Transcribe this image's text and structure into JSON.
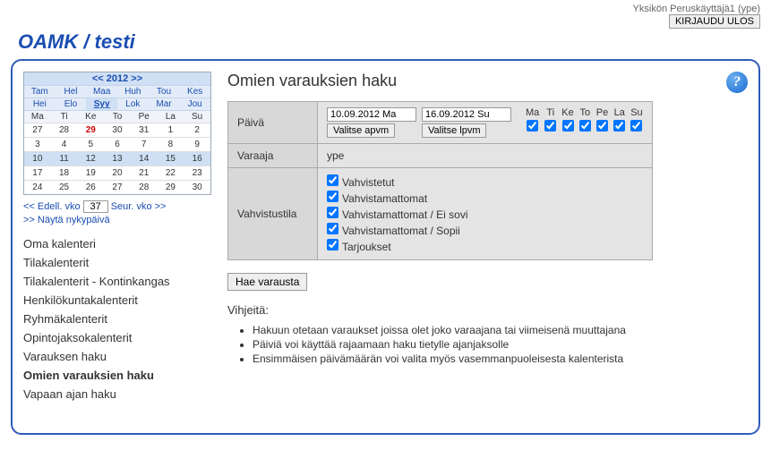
{
  "topbar": {
    "user": "Yksikön Peruskäyttäjä1 (ype)",
    "logout": "KIRJAUDU ULOS"
  },
  "header": {
    "title": "OAMK / testi"
  },
  "calendar": {
    "year_nav": "<< 2012 >>",
    "months_row1": [
      "Tam",
      "Hel",
      "Maa",
      "Huh",
      "Tou",
      "Kes"
    ],
    "months_row2": [
      "Hei",
      "Elo",
      "Syy",
      "Lok",
      "Mar",
      "Jou"
    ],
    "active_month": "Syy",
    "day_headers": [
      "Ma",
      "Ti",
      "Ke",
      "To",
      "Pe",
      "La",
      "Su"
    ],
    "weeks": [
      [
        "27",
        "28",
        "29",
        "30",
        "31",
        "1",
        "2"
      ],
      [
        "3",
        "4",
        "5",
        "6",
        "7",
        "8",
        "9"
      ],
      [
        "10",
        "11",
        "12",
        "13",
        "14",
        "15",
        "16"
      ],
      [
        "17",
        "18",
        "19",
        "20",
        "21",
        "22",
        "23"
      ],
      [
        "24",
        "25",
        "26",
        "27",
        "28",
        "29",
        "30"
      ]
    ],
    "today": "29",
    "highlight_row": 2,
    "prev_week": "<< Edell. vko",
    "week_num": "37",
    "next_week": "Seur. vko >>",
    "show_today": ">> Näytä nykypäivä"
  },
  "nav": {
    "items": [
      "Oma kalenteri",
      "Tilakalenterit",
      "Tilakalenterit - Kontinkangas",
      "Henkilökuntakalenterit",
      "Ryhmäkalenterit",
      "Opintojaksokalenterit",
      "Varauksen haku",
      "Omien varauksien haku",
      "Vapaan ajan haku"
    ],
    "active": "Omien varauksien haku"
  },
  "content": {
    "title": "Omien varauksien haku",
    "help": "?",
    "labels": {
      "day": "Päivä",
      "reserver": "Varaaja",
      "status": "Vahvistustila"
    },
    "date_from": "10.09.2012 Ma",
    "date_to": "16.09.2012 Su",
    "btn_from": "Valitse apvm",
    "btn_to": "Valitse lpvm",
    "day_short": [
      "Ma",
      "Ti",
      "Ke",
      "To",
      "Pe",
      "La",
      "Su"
    ],
    "reserver": "ype",
    "statuses": [
      "Vahvistetut",
      "Vahvistamattomat",
      "Vahvistamattomat / Ei sovi",
      "Vahvistamattomat / Sopii",
      "Tarjoukset"
    ],
    "search_btn": "Hae varausta",
    "hints_title": "Vihjeitä:",
    "hints": [
      "Hakuun otetaan varaukset joissa olet joko varaajana tai viimeisenä muuttajana",
      "Päiviä voi käyttää rajaamaan haku tietylle ajanjaksolle",
      "Ensimmäisen päivämäärän voi valita myös vasemmanpuoleisesta kalenterista"
    ]
  }
}
